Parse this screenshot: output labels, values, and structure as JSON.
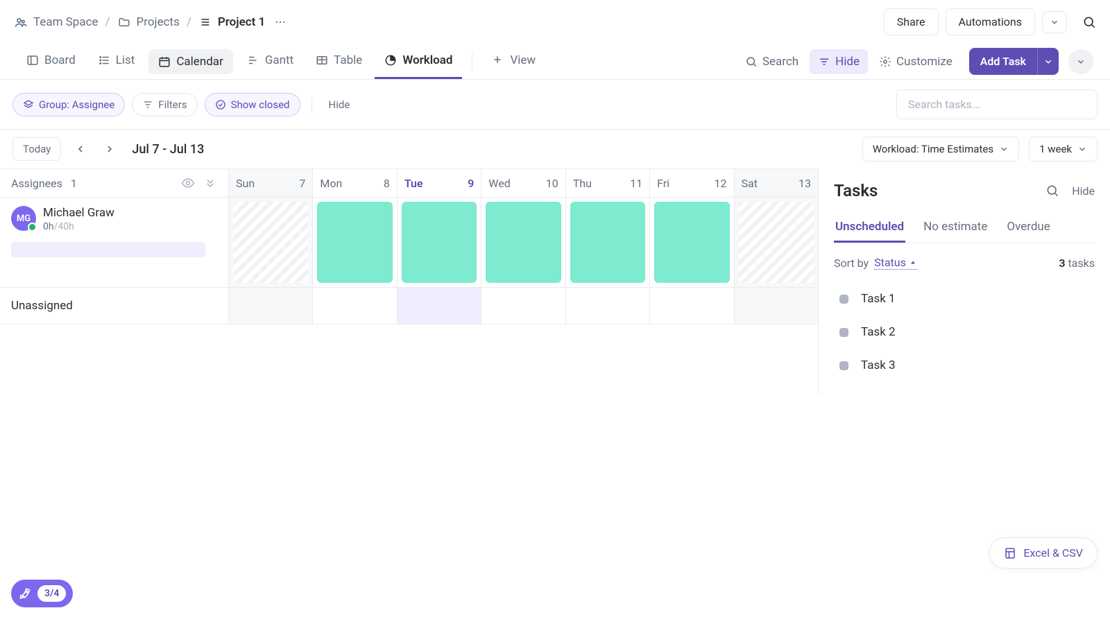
{
  "breadcrumb": {
    "space": "Team Space",
    "parent": "Projects",
    "current": "Project 1"
  },
  "header": {
    "share": "Share",
    "automations": "Automations"
  },
  "views": {
    "board": "Board",
    "list": "List",
    "calendar": "Calendar",
    "gantt": "Gantt",
    "table": "Table",
    "workload": "Workload",
    "add_view": "View"
  },
  "tools": {
    "search": "Search",
    "hide": "Hide",
    "customize": "Customize",
    "add_task": "Add Task"
  },
  "filters": {
    "group": "Group: Assignee",
    "filters": "Filters",
    "show_closed": "Show closed",
    "hide": "Hide",
    "search_placeholder": "Search tasks..."
  },
  "date_nav": {
    "today": "Today",
    "range": "Jul 7 - Jul 13",
    "workload_mode": "Workload: Time Estimates",
    "span": "1 week"
  },
  "grid": {
    "assignees_label": "Assignees",
    "assignees_count": "1",
    "days": [
      {
        "dow": "Sun",
        "num": "7",
        "weekend": true,
        "today": false
      },
      {
        "dow": "Mon",
        "num": "8",
        "weekend": false,
        "today": false
      },
      {
        "dow": "Tue",
        "num": "9",
        "weekend": false,
        "today": true
      },
      {
        "dow": "Wed",
        "num": "10",
        "weekend": false,
        "today": false
      },
      {
        "dow": "Thu",
        "num": "11",
        "weekend": false,
        "today": false
      },
      {
        "dow": "Fri",
        "num": "12",
        "weekend": false,
        "today": false
      },
      {
        "dow": "Sat",
        "num": "13",
        "weekend": true,
        "today": false
      }
    ],
    "assignee": {
      "initials": "MG",
      "name": "Michael Graw",
      "hours_used": "0h",
      "hours_total": "/40h"
    },
    "unassigned": "Unassigned"
  },
  "tasks_panel": {
    "title": "Tasks",
    "hide": "Hide",
    "tabs": {
      "unscheduled": "Unscheduled",
      "no_estimate": "No estimate",
      "overdue": "Overdue"
    },
    "sort_label": "Sort by",
    "sort_field": "Status",
    "count_num": "3",
    "count_word": "tasks",
    "items": [
      "Task 1",
      "Task 2",
      "Task 3"
    ]
  },
  "onboarding": "3/4",
  "export": "Excel & CSV"
}
